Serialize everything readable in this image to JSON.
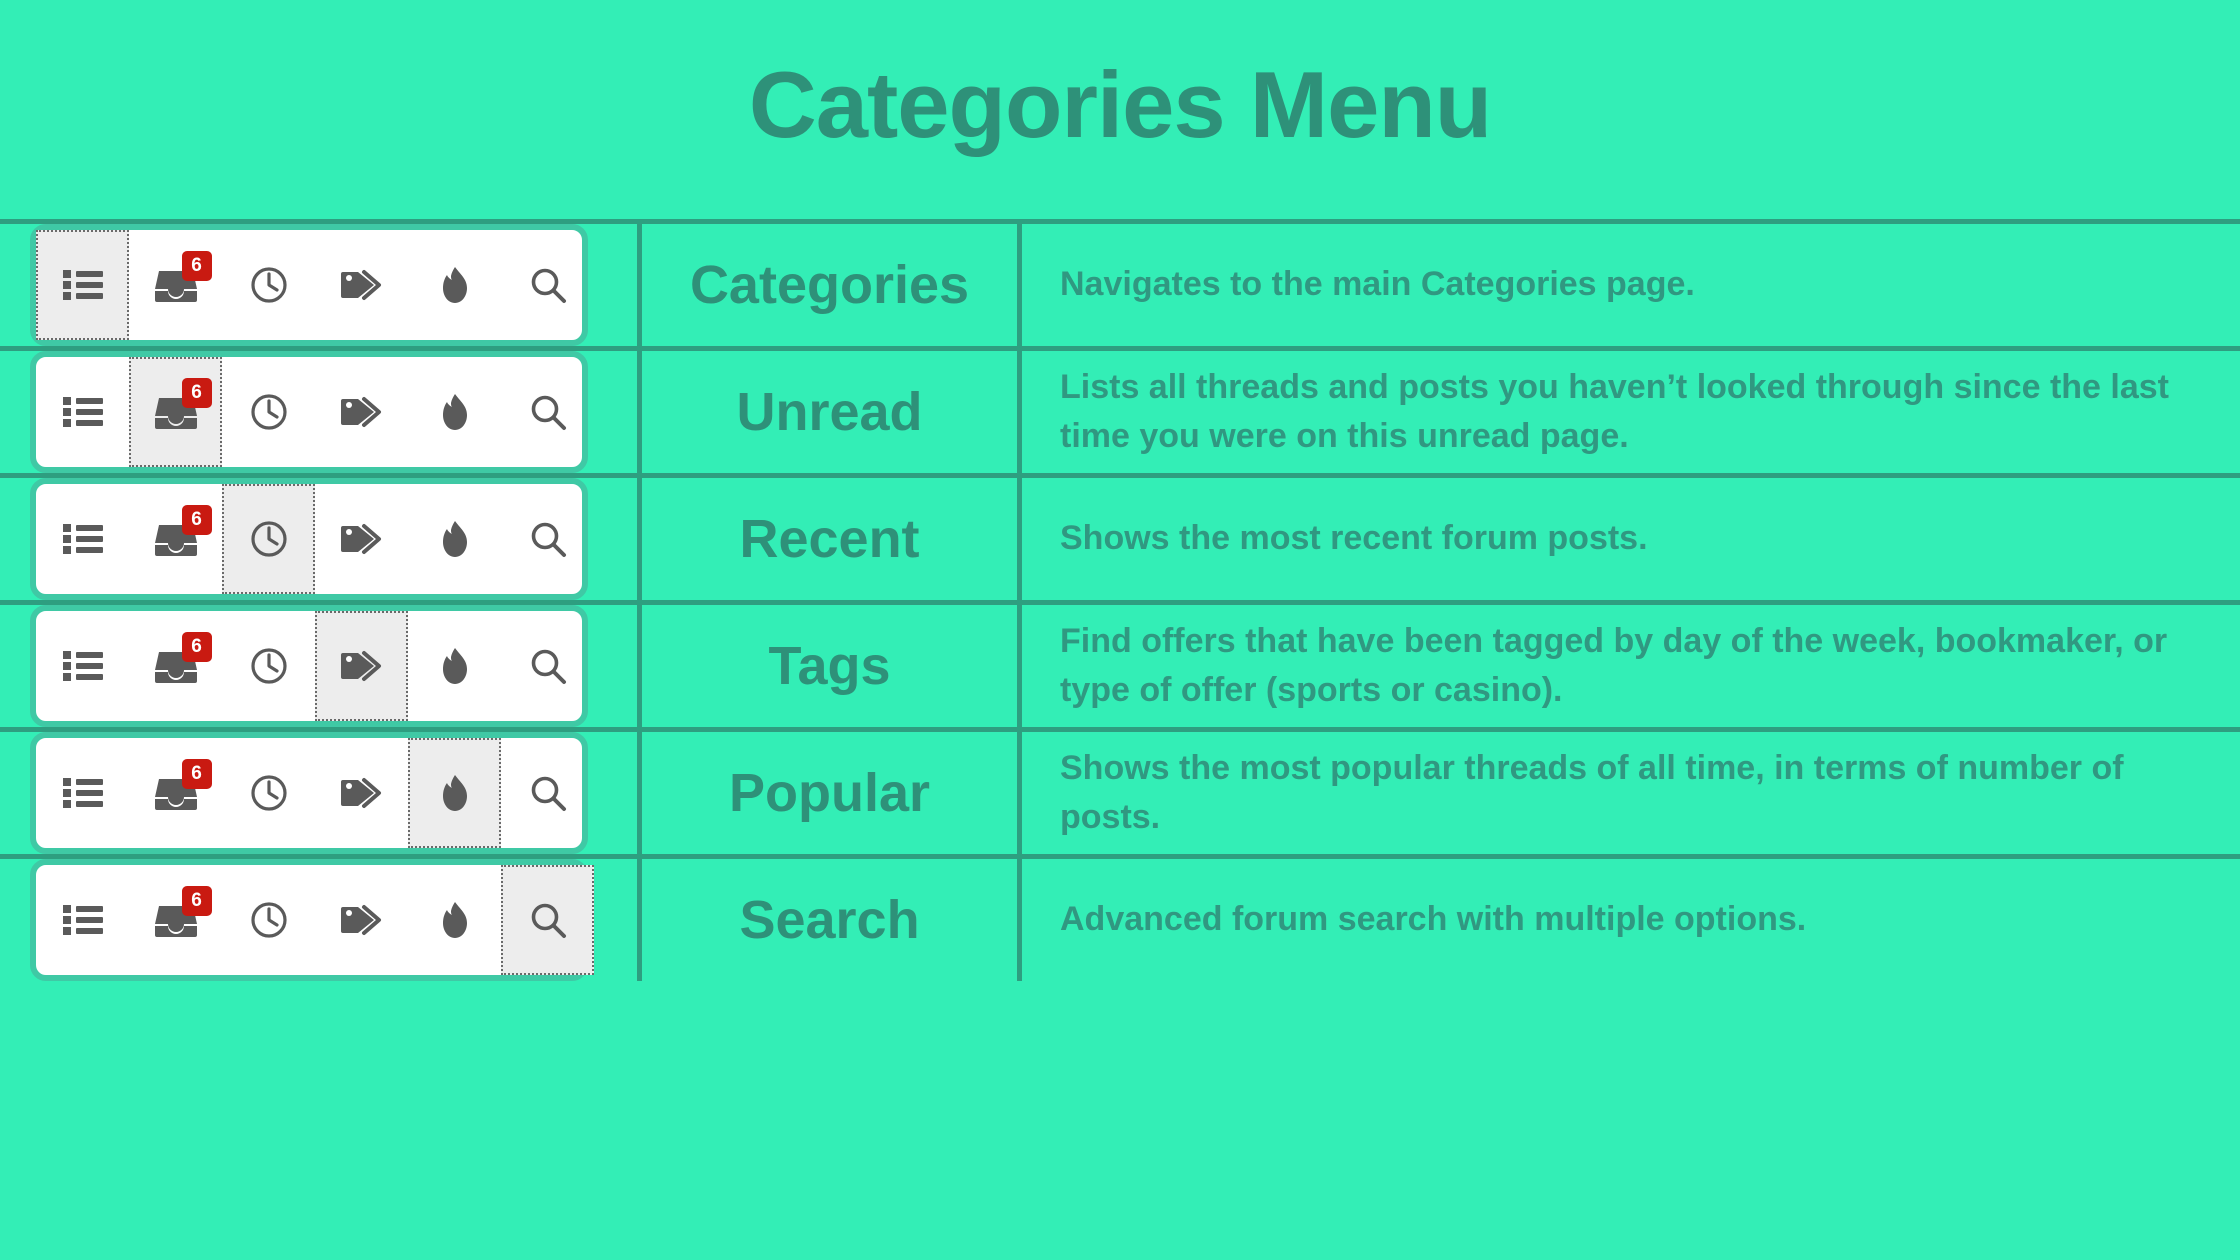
{
  "header": {
    "title": "Categories Menu"
  },
  "colors": {
    "background": "#33EEB6",
    "border": "#2E9E80",
    "title_text": "#2E9179",
    "label_text": "#2E9179",
    "desc_text": "#309881",
    "toolbar_card_border": "#3FC9A5",
    "toolbar_card_bg": "#FFFFFF",
    "icon": "#5A5A5A",
    "badge_bg": "#C91A11",
    "badge_text": "#FFFFFF",
    "selected_bg": "#EDEDED"
  },
  "toolbar": {
    "badge_count": "6",
    "icons": [
      {
        "name": "list-icon",
        "title": "Categories"
      },
      {
        "name": "inbox-icon",
        "title": "Unread"
      },
      {
        "name": "clock-icon",
        "title": "Recent"
      },
      {
        "name": "tags-icon",
        "title": "Tags"
      },
      {
        "name": "flame-icon",
        "title": "Popular"
      },
      {
        "name": "search-icon",
        "title": "Search"
      }
    ]
  },
  "rows": [
    {
      "selected_index": 0,
      "label": "Categories",
      "description": "Navigates to the main Categories page."
    },
    {
      "selected_index": 1,
      "label": "Unread",
      "description": "Lists all threads and posts you haven’t looked through since the last time you were on this unread page."
    },
    {
      "selected_index": 2,
      "label": "Recent",
      "description": "Shows the most recent forum posts."
    },
    {
      "selected_index": 3,
      "label": "Tags",
      "description": "Find offers that have been tagged by day of the week, bookmaker, or type of offer (sports or casino)."
    },
    {
      "selected_index": 4,
      "label": "Popular",
      "description": "Shows the most popular threads of all time, in terms of number of posts."
    },
    {
      "selected_index": 5,
      "label": "Search",
      "description": "Advanced forum search with multiple options."
    }
  ]
}
